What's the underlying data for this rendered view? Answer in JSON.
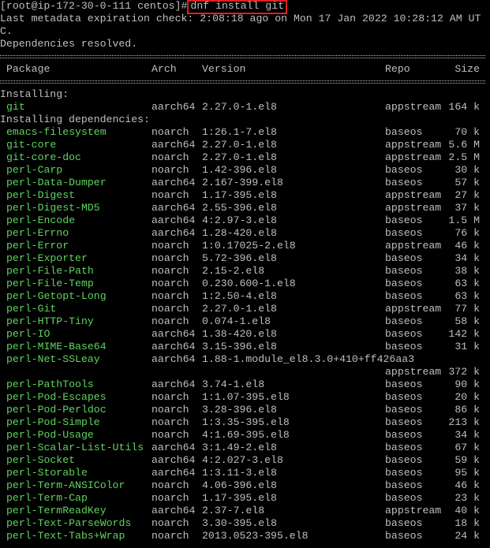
{
  "terminal": {
    "prompt": "[root@ip-172-30-0-111 centos]#",
    "command": "dnf install git",
    "metadata_line1": "Last metadata expiration check: 2:08:18 ago on Mon 17 Jan 2022 10:28:12 AM UT",
    "metadata_line2": "C.",
    "deps_resolved": "Dependencies resolved."
  },
  "colors": {
    "background": "#000000",
    "text": "#bfbfbf",
    "package": "#5fd35f",
    "highlight_border": "#e02020"
  },
  "table": {
    "headers": {
      "package": "Package",
      "arch": "Arch",
      "version": "Version",
      "repo": "Repo",
      "size": "Size"
    },
    "installing_label": "Installing:",
    "installing": [
      {
        "name": "git",
        "arch": "aarch64",
        "version": "2.27.0-1.el8",
        "repo": "appstream",
        "size": "164 k"
      }
    ],
    "deps_label": "Installing dependencies:",
    "dependencies": [
      {
        "name": "emacs-filesystem",
        "arch": "noarch",
        "version": "1:26.1-7.el8",
        "repo": "baseos",
        "size": "70 k"
      },
      {
        "name": "git-core",
        "arch": "aarch64",
        "version": "2.27.0-1.el8",
        "repo": "appstream",
        "size": "5.6 M"
      },
      {
        "name": "git-core-doc",
        "arch": "noarch",
        "version": "2.27.0-1.el8",
        "repo": "appstream",
        "size": "2.5 M"
      },
      {
        "name": "perl-Carp",
        "arch": "noarch",
        "version": "1.42-396.el8",
        "repo": "baseos",
        "size": "30 k"
      },
      {
        "name": "perl-Data-Dumper",
        "arch": "aarch64",
        "version": "2.167-399.el8",
        "repo": "baseos",
        "size": "57 k"
      },
      {
        "name": "perl-Digest",
        "arch": "noarch",
        "version": "1.17-395.el8",
        "repo": "appstream",
        "size": "27 k"
      },
      {
        "name": "perl-Digest-MD5",
        "arch": "aarch64",
        "version": "2.55-396.el8",
        "repo": "appstream",
        "size": "37 k"
      },
      {
        "name": "perl-Encode",
        "arch": "aarch64",
        "version": "4:2.97-3.el8",
        "repo": "baseos",
        "size": "1.5 M"
      },
      {
        "name": "perl-Errno",
        "arch": "aarch64",
        "version": "1.28-420.el8",
        "repo": "baseos",
        "size": "76 k"
      },
      {
        "name": "perl-Error",
        "arch": "noarch",
        "version": "1:0.17025-2.el8",
        "repo": "appstream",
        "size": "46 k"
      },
      {
        "name": "perl-Exporter",
        "arch": "noarch",
        "version": "5.72-396.el8",
        "repo": "baseos",
        "size": "34 k"
      },
      {
        "name": "perl-File-Path",
        "arch": "noarch",
        "version": "2.15-2.el8",
        "repo": "baseos",
        "size": "38 k"
      },
      {
        "name": "perl-File-Temp",
        "arch": "noarch",
        "version": "0.230.600-1.el8",
        "repo": "baseos",
        "size": "63 k"
      },
      {
        "name": "perl-Getopt-Long",
        "arch": "noarch",
        "version": "1:2.50-4.el8",
        "repo": "baseos",
        "size": "63 k"
      },
      {
        "name": "perl-Git",
        "arch": "noarch",
        "version": "2.27.0-1.el8",
        "repo": "appstream",
        "size": "77 k"
      },
      {
        "name": "perl-HTTP-Tiny",
        "arch": "noarch",
        "version": "0.074-1.el8",
        "repo": "baseos",
        "size": "58 k"
      },
      {
        "name": "perl-IO",
        "arch": "aarch64",
        "version": "1.38-420.el8",
        "repo": "baseos",
        "size": "142 k"
      },
      {
        "name": "perl-MIME-Base64",
        "arch": "aarch64",
        "version": "3.15-396.el8",
        "repo": "baseos",
        "size": "31 k"
      },
      {
        "name": "perl-Net-SSLeay",
        "arch": "aarch64",
        "version": "1.88-1.module_el8.3.0+410+ff426aa3",
        "repo": "",
        "size": ""
      },
      {
        "name": "",
        "arch": "",
        "version": "",
        "repo": "appstream",
        "size": "372 k"
      },
      {
        "name": "perl-PathTools",
        "arch": "aarch64",
        "version": "3.74-1.el8",
        "repo": "baseos",
        "size": "90 k"
      },
      {
        "name": "perl-Pod-Escapes",
        "arch": "noarch",
        "version": "1:1.07-395.el8",
        "repo": "baseos",
        "size": "20 k"
      },
      {
        "name": "perl-Pod-Perldoc",
        "arch": "noarch",
        "version": "3.28-396.el8",
        "repo": "baseos",
        "size": "86 k"
      },
      {
        "name": "perl-Pod-Simple",
        "arch": "noarch",
        "version": "1:3.35-395.el8",
        "repo": "baseos",
        "size": "213 k"
      },
      {
        "name": "perl-Pod-Usage",
        "arch": "noarch",
        "version": "4:1.69-395.el8",
        "repo": "baseos",
        "size": "34 k"
      },
      {
        "name": "perl-Scalar-List-Utils",
        "arch": "aarch64",
        "version": "3:1.49-2.el8",
        "repo": "baseos",
        "size": "67 k"
      },
      {
        "name": "perl-Socket",
        "arch": "aarch64",
        "version": "4:2.027-3.el8",
        "repo": "baseos",
        "size": "59 k"
      },
      {
        "name": "perl-Storable",
        "arch": "aarch64",
        "version": "1:3.11-3.el8",
        "repo": "baseos",
        "size": "95 k"
      },
      {
        "name": "perl-Term-ANSIColor",
        "arch": "noarch",
        "version": "4.06-396.el8",
        "repo": "baseos",
        "size": "46 k"
      },
      {
        "name": "perl-Term-Cap",
        "arch": "noarch",
        "version": "1.17-395.el8",
        "repo": "baseos",
        "size": "23 k"
      },
      {
        "name": "perl-TermReadKey",
        "arch": "aarch64",
        "version": "2.37-7.el8",
        "repo": "appstream",
        "size": "40 k"
      },
      {
        "name": "perl-Text-ParseWords",
        "arch": "noarch",
        "version": "3.30-395.el8",
        "repo": "baseos",
        "size": "18 k"
      },
      {
        "name": "perl-Text-Tabs+Wrap",
        "arch": "noarch",
        "version": "2013.0523-395.el8",
        "repo": "baseos",
        "size": "24 k"
      }
    ]
  }
}
